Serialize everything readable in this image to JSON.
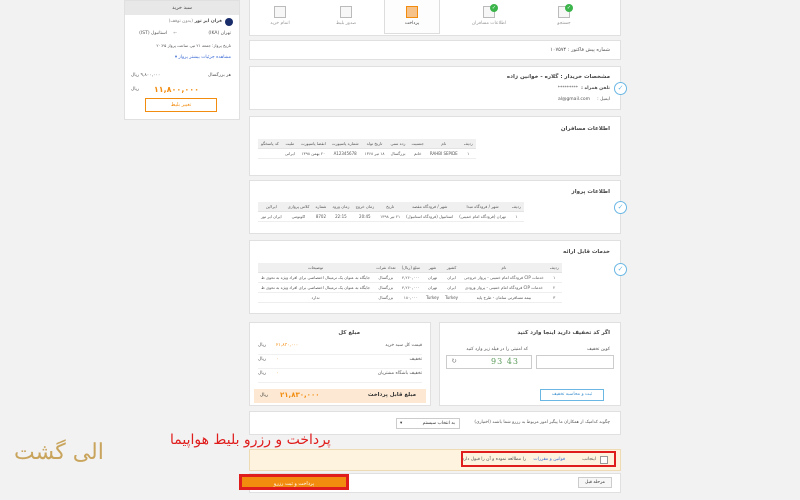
{
  "sidebar": {
    "title": "سبد خرید",
    "airline": "قران ایر تور",
    "airline_note": "(بدون توقف)",
    "from": "تهران (IKA)",
    "to": "استانبول (IST)",
    "date_line": "تاریخ پرواز: جمعه ۲۱ تیر، ساعت پرواز ۲۰:۴۵",
    "details_link": "مشاهده جزئیات بیشتر پرواز ▾",
    "total_label": "هر بزرگسال",
    "total_small": "۹,۸۰۰,۰۰۰ ریال",
    "price_big": "۱۱,۸۰۰,۰۰۰",
    "price_unit": "ریال",
    "change_button": "تغییر بلیط"
  },
  "steps": [
    {
      "label": "جستجو",
      "done": true
    },
    {
      "label": "اطلاعات مسافران",
      "done": true
    },
    {
      "label": "پرداخت",
      "done": false,
      "active": true
    },
    {
      "label": "صدور بلیط",
      "done": false
    },
    {
      "label": "اتمام خرید",
      "done": false
    }
  ],
  "invoice": {
    "label": "شماره پیش فاکتور :",
    "number": "۱۰۷۵۷۴"
  },
  "buyer": {
    "title": "مشخصات خریدار : گلاره - خوانین زاده",
    "phone_label": "تلفن همراه :",
    "phone_value": "*********",
    "email_label": "ایمیل :",
    "email_value": "al@gmail.com"
  },
  "passengers": {
    "title": "اطلاعات مسافران",
    "headers": [
      "ردیف",
      "نام",
      "جنسیت",
      "رده سنی",
      "تاریخ تولد",
      "شماره پاسپورت",
      "انقضا پاسپورت",
      "ملیت",
      "کد پاسخگو"
    ],
    "rows": [
      [
        "۱",
        "RAHBI SEPIDE",
        "خانم",
        "بزرگسال",
        "۱۸ تیر ۱۳۶۸",
        "A12345678",
        "۲۰ بهمن ۱۳۹۸",
        "ایرانی",
        ""
      ]
    ]
  },
  "flight": {
    "title": "اطلاعات پرواز",
    "headers": [
      "ردیف",
      "شهر / فرودگاه مبدا",
      "شهر / فرودگاه مقصد",
      "تاریخ",
      "زمان خروج",
      "زمان ورود",
      "شماره",
      "کلاس پروازی",
      "ایرلاین"
    ],
    "rows": [
      [
        "۱",
        "تهران (فرودگاه امام خمینی)",
        "استانبول (فرودگاه استانبول)",
        "۲۱ تیر ۱۳۹۸",
        "20:45",
        "22:15",
        "8702",
        "اکونومی",
        "ایران ایر تور"
      ]
    ]
  },
  "services": {
    "title": "خدمات قابل ارائه",
    "headers": [
      "ردیف",
      "نام",
      "کشور",
      "شهر",
      "مبلغ (ریال)",
      "تعداد نفرات",
      "توضیحات"
    ],
    "rows": [
      [
        "۱",
        "خدمات CIP فرودگاه امام خمینی - پرواز خروجی",
        "ایران",
        "تهران",
        "۴,۲۶۰,۰۰۰",
        "بزرگسال",
        "جایگاه به عنوان یک ترمینال اختصاصی برای افراد ویژه به نحوی ط"
      ],
      [
        "۲",
        "خدمات CIP فرودگاه امام خمینی - پرواز ورودی",
        "ایران",
        "تهران",
        "۴,۲۶۰,۰۰۰",
        "بزرگسال",
        "جایگاه به عنوان یک ترمینال اختصاصی برای افراد ویژه به نحوی ط"
      ],
      [
        "۳",
        "بیمه مسافرتی سامان - طرح پایه",
        "Turkey",
        "Turkey",
        "۱۸۰,۰۰۰",
        "بزرگسال",
        "ندارد"
      ]
    ]
  },
  "discount": {
    "title": "اگر کد تخفیف دارید اینجا وارد کنید",
    "code_label": "کوپن تخفیف",
    "captcha_label": "کد امنیتی را در فیلد زیر وارد کنید",
    "captcha_text": "93 43",
    "register_button": "ثبت و محاسبه تخفیف"
  },
  "summary": {
    "title": "مبلغ کل",
    "rows": [
      {
        "label": "قیمت کل سبد خرید",
        "value": "۲۱,۸۳۰,۰۰۰",
        "unit": "ریال"
      },
      {
        "label": "تخفیف",
        "value": "۰",
        "unit": "ریال"
      },
      {
        "label": "تخفیف باشگاه مشتریان",
        "value": "۰",
        "unit": "ریال"
      }
    ],
    "total_label": "مبلغ قابل پرداخت",
    "total_value": "۲۱,۸۳۰,۰۰۰",
    "total_unit": "ریال"
  },
  "referral": {
    "question": "چگونه کدامیک از همکاران ما پیگیر امور مربوط به رزرو شما باشند (اختیاری)",
    "select_value": "به انتخاب سیستم"
  },
  "terms": {
    "prefix": "اینجانب",
    "link": "قوانین و مقررات",
    "suffix": "را مطالعه نموده و آن را قبول دارم"
  },
  "buttons": {
    "pay": "پرداخت و ثبت رزرو",
    "prev": "مرحله قبل"
  },
  "caption": "پرداخت و رزرو بلیط هواپیما",
  "logo_text": "الی گشت",
  "colors": {
    "accent": "#f28c0f",
    "highlight": "#e01d1d",
    "check": "#3bb54a",
    "info": "#6ab7e4"
  }
}
